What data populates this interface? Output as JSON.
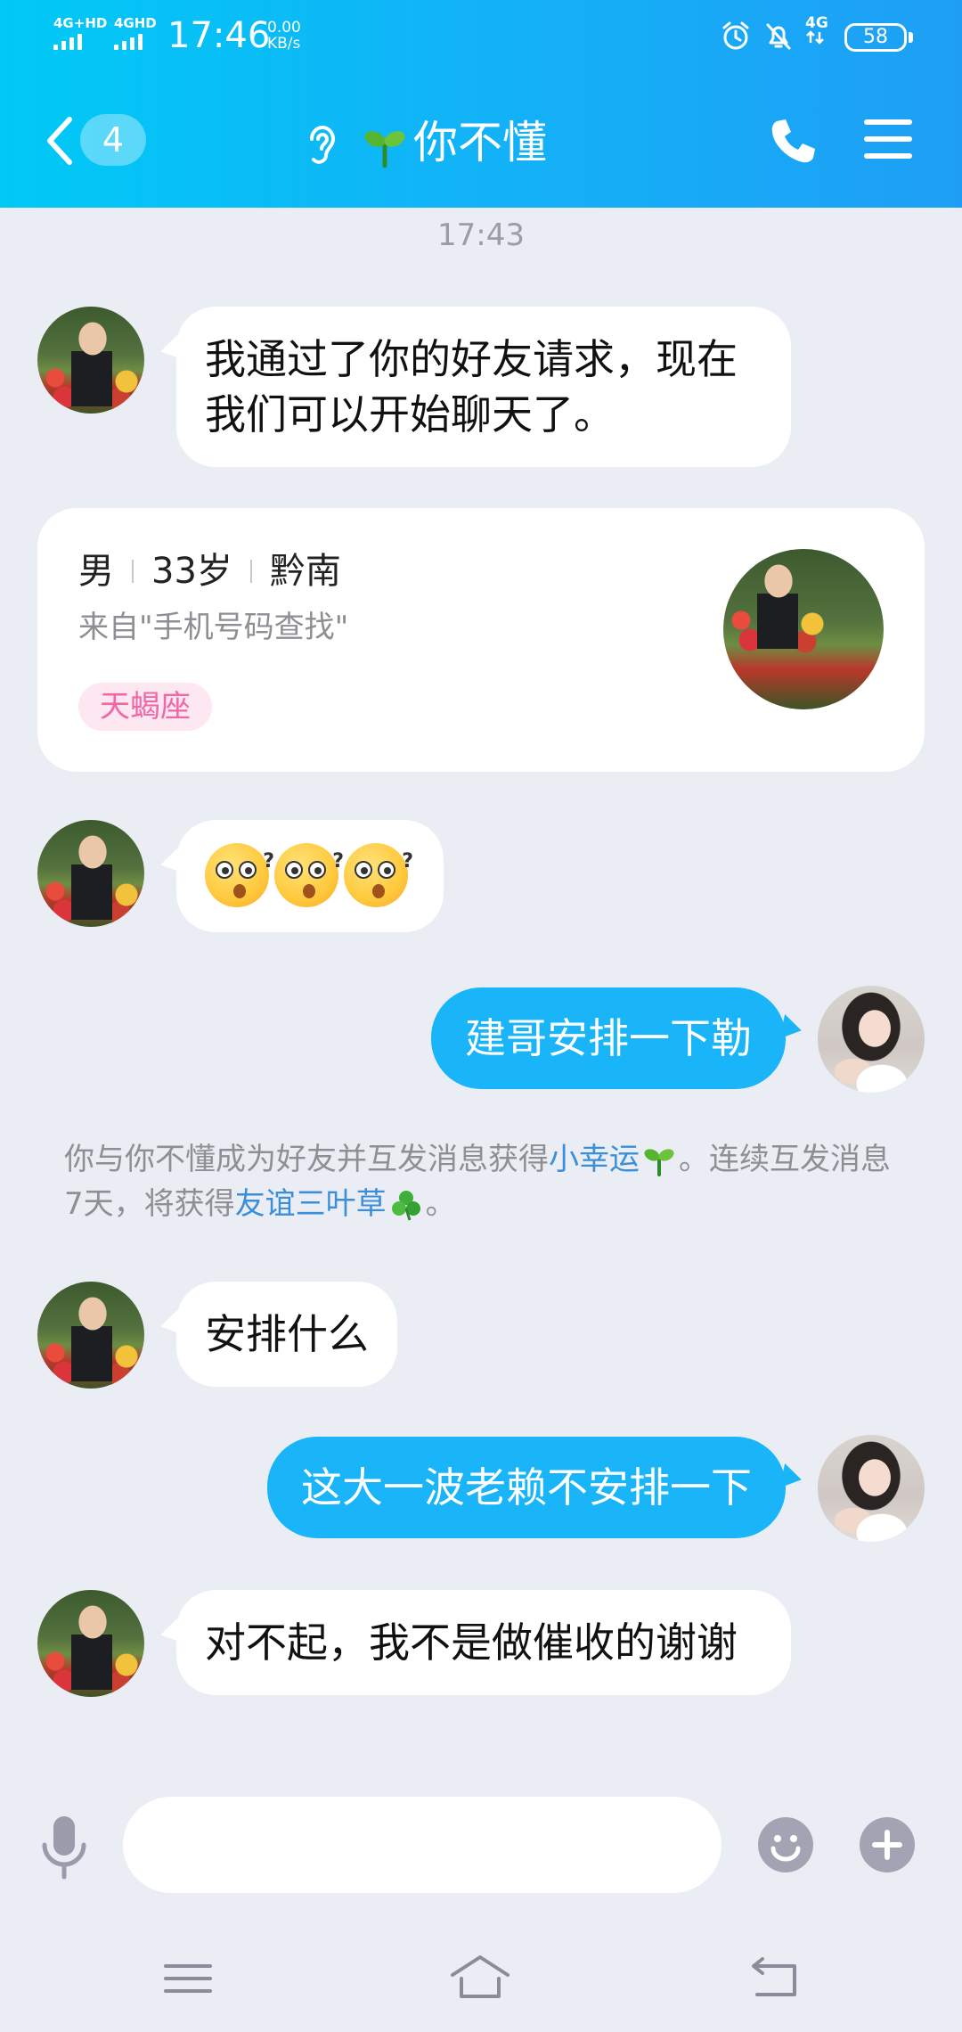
{
  "status_bar": {
    "network1": "4G+HD",
    "network2": "4GHD",
    "time": "17:46",
    "speed_value": "0.00",
    "speed_unit": "KB/s",
    "mobile_data": "4G",
    "battery": "58"
  },
  "header": {
    "unread_count": "4",
    "title": "你不懂",
    "icons": [
      "back-chevron-icon",
      "ear-icon",
      "sprout-icon",
      "phone-icon",
      "menu-icon"
    ]
  },
  "messages": {
    "timestamp": "17:43",
    "msg1": "我通过了你的好友请求，现在我们可以开始聊天了。",
    "profile": {
      "gender": "男",
      "age": "33岁",
      "location": "黔南",
      "source": "来自\"手机号码查找\"",
      "zodiac": "天蝎座"
    },
    "msg3": "建哥安排一下勒",
    "notice": {
      "part1": "你与你不懂成为好友并互发消息获得",
      "link1": "小幸运",
      "part2": "。连续互发消息7天，将获得",
      "link2": "友谊三叶草",
      "part3": "。"
    },
    "msg4": "安排什么",
    "msg5": "这大一波老赖不安排一下",
    "msg6": "对不起，我不是做催收的谢谢"
  },
  "input": {
    "placeholder": ""
  },
  "colors": {
    "header_start": "#00c9f6",
    "header_end": "#1e9ff5",
    "out_bubble": "#19b5f8",
    "background": "#ebedf5",
    "link": "#3b8fd9",
    "zodiac_tag": "#f067a8"
  }
}
